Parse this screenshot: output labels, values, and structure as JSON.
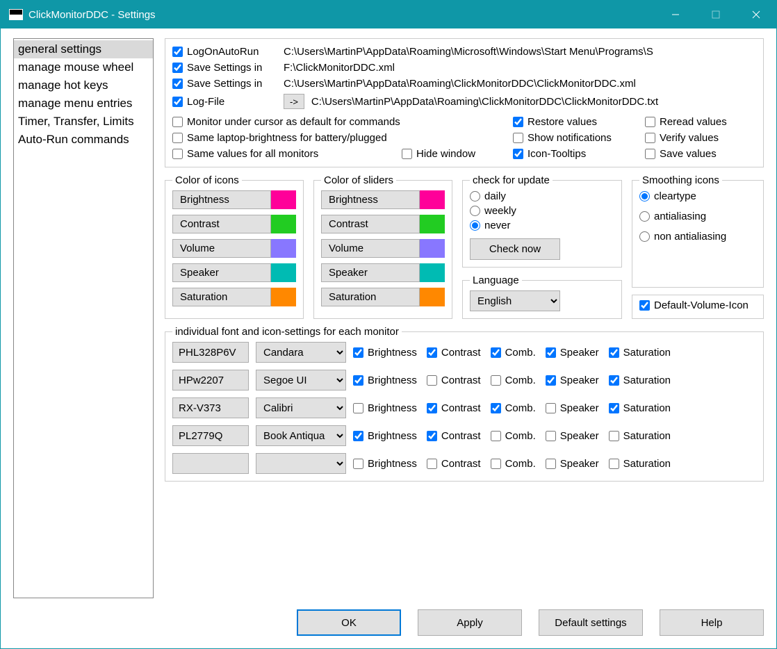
{
  "title": "ClickMonitorDDC - Settings",
  "sidebar": {
    "items": [
      {
        "label": "general settings",
        "selected": true
      },
      {
        "label": "manage mouse wheel"
      },
      {
        "label": "manage hot keys"
      },
      {
        "label": "manage menu entries"
      },
      {
        "label": "Timer, Transfer, Limits"
      },
      {
        "label": "Auto-Run commands"
      }
    ]
  },
  "toprows": [
    {
      "checked": true,
      "label": "LogOnAutoRun",
      "btn": null,
      "path": "C:\\Users\\MartinP\\AppData\\Roaming\\Microsoft\\Windows\\Start Menu\\Programs\\S"
    },
    {
      "checked": true,
      "label": "Save Settings in",
      "btn": null,
      "path": "F:\\ClickMonitorDDC.xml"
    },
    {
      "checked": true,
      "label": "Save Settings in",
      "btn": null,
      "path": "C:\\Users\\MartinP\\AppData\\Roaming\\ClickMonitorDDC\\ClickMonitorDDC.xml"
    },
    {
      "checked": true,
      "label": "Log-File",
      "btn": "->",
      "path": "C:\\Users\\MartinP\\AppData\\Roaming\\ClickMonitorDDC\\ClickMonitorDDC.txt"
    }
  ],
  "options": {
    "row1": [
      {
        "label": "Monitor under cursor as default for commands",
        "checked": false,
        "span": 2
      },
      {
        "label": "Restore values",
        "checked": true
      },
      {
        "label": "Reread values",
        "checked": false
      }
    ],
    "row2": [
      {
        "label": "Same laptop-brightness for battery/plugged",
        "checked": false,
        "span": 2
      },
      {
        "label": "Show notifications",
        "checked": false
      },
      {
        "label": "Verify values",
        "checked": false
      }
    ],
    "row3": [
      {
        "label": "Same values for all monitors",
        "checked": false
      },
      {
        "label": "Hide window",
        "checked": false
      },
      {
        "label": "Icon-Tooltips",
        "checked": true
      },
      {
        "label": "Save values",
        "checked": false
      }
    ]
  },
  "color_icons": {
    "title": "Color of icons",
    "items": [
      {
        "label": "Brightness",
        "color": "#ff0099"
      },
      {
        "label": "Contrast",
        "color": "#22cc22"
      },
      {
        "label": "Volume",
        "color": "#8877ff"
      },
      {
        "label": "Speaker",
        "color": "#00bbb3"
      },
      {
        "label": "Saturation",
        "color": "#ff8800"
      }
    ]
  },
  "color_sliders": {
    "title": "Color of sliders",
    "items": [
      {
        "label": "Brightness",
        "color": "#ff0099"
      },
      {
        "label": "Contrast",
        "color": "#22cc22"
      },
      {
        "label": "Volume",
        "color": "#8877ff"
      },
      {
        "label": "Speaker",
        "color": "#00bbb3"
      },
      {
        "label": "Saturation",
        "color": "#ff8800"
      }
    ]
  },
  "update": {
    "title": "check for update",
    "options": [
      "daily",
      "weekly",
      "never"
    ],
    "selected": "never",
    "button": "Check now"
  },
  "language": {
    "title": "Language",
    "value": "English"
  },
  "smoothing": {
    "title": "Smoothing icons",
    "options": [
      "cleartype",
      "antialiasing",
      "non antialiasing"
    ],
    "selected": "cleartype"
  },
  "default_volume_icon": {
    "label": "Default-Volume-Icon",
    "checked": true
  },
  "monitors": {
    "title": "individual font and icon-settings for each monitor",
    "cols": [
      "Brightness",
      "Contrast",
      "Comb.",
      "Speaker",
      "Saturation"
    ],
    "rows": [
      {
        "name": "PHL328P6V",
        "font": "Candara",
        "checks": [
          true,
          true,
          true,
          true,
          true
        ]
      },
      {
        "name": "HPw2207",
        "font": "Segoe UI",
        "checks": [
          true,
          false,
          false,
          true,
          true
        ]
      },
      {
        "name": "RX-V373",
        "font": "Calibri",
        "checks": [
          false,
          true,
          true,
          false,
          true
        ]
      },
      {
        "name": "PL2779Q",
        "font": "Book Antiqua",
        "checks": [
          true,
          true,
          false,
          false,
          false
        ]
      },
      {
        "name": "",
        "font": "",
        "checks": [
          false,
          false,
          false,
          false,
          false
        ]
      }
    ]
  },
  "footer": {
    "ok": "OK",
    "apply": "Apply",
    "defaults": "Default settings",
    "help": "Help"
  }
}
